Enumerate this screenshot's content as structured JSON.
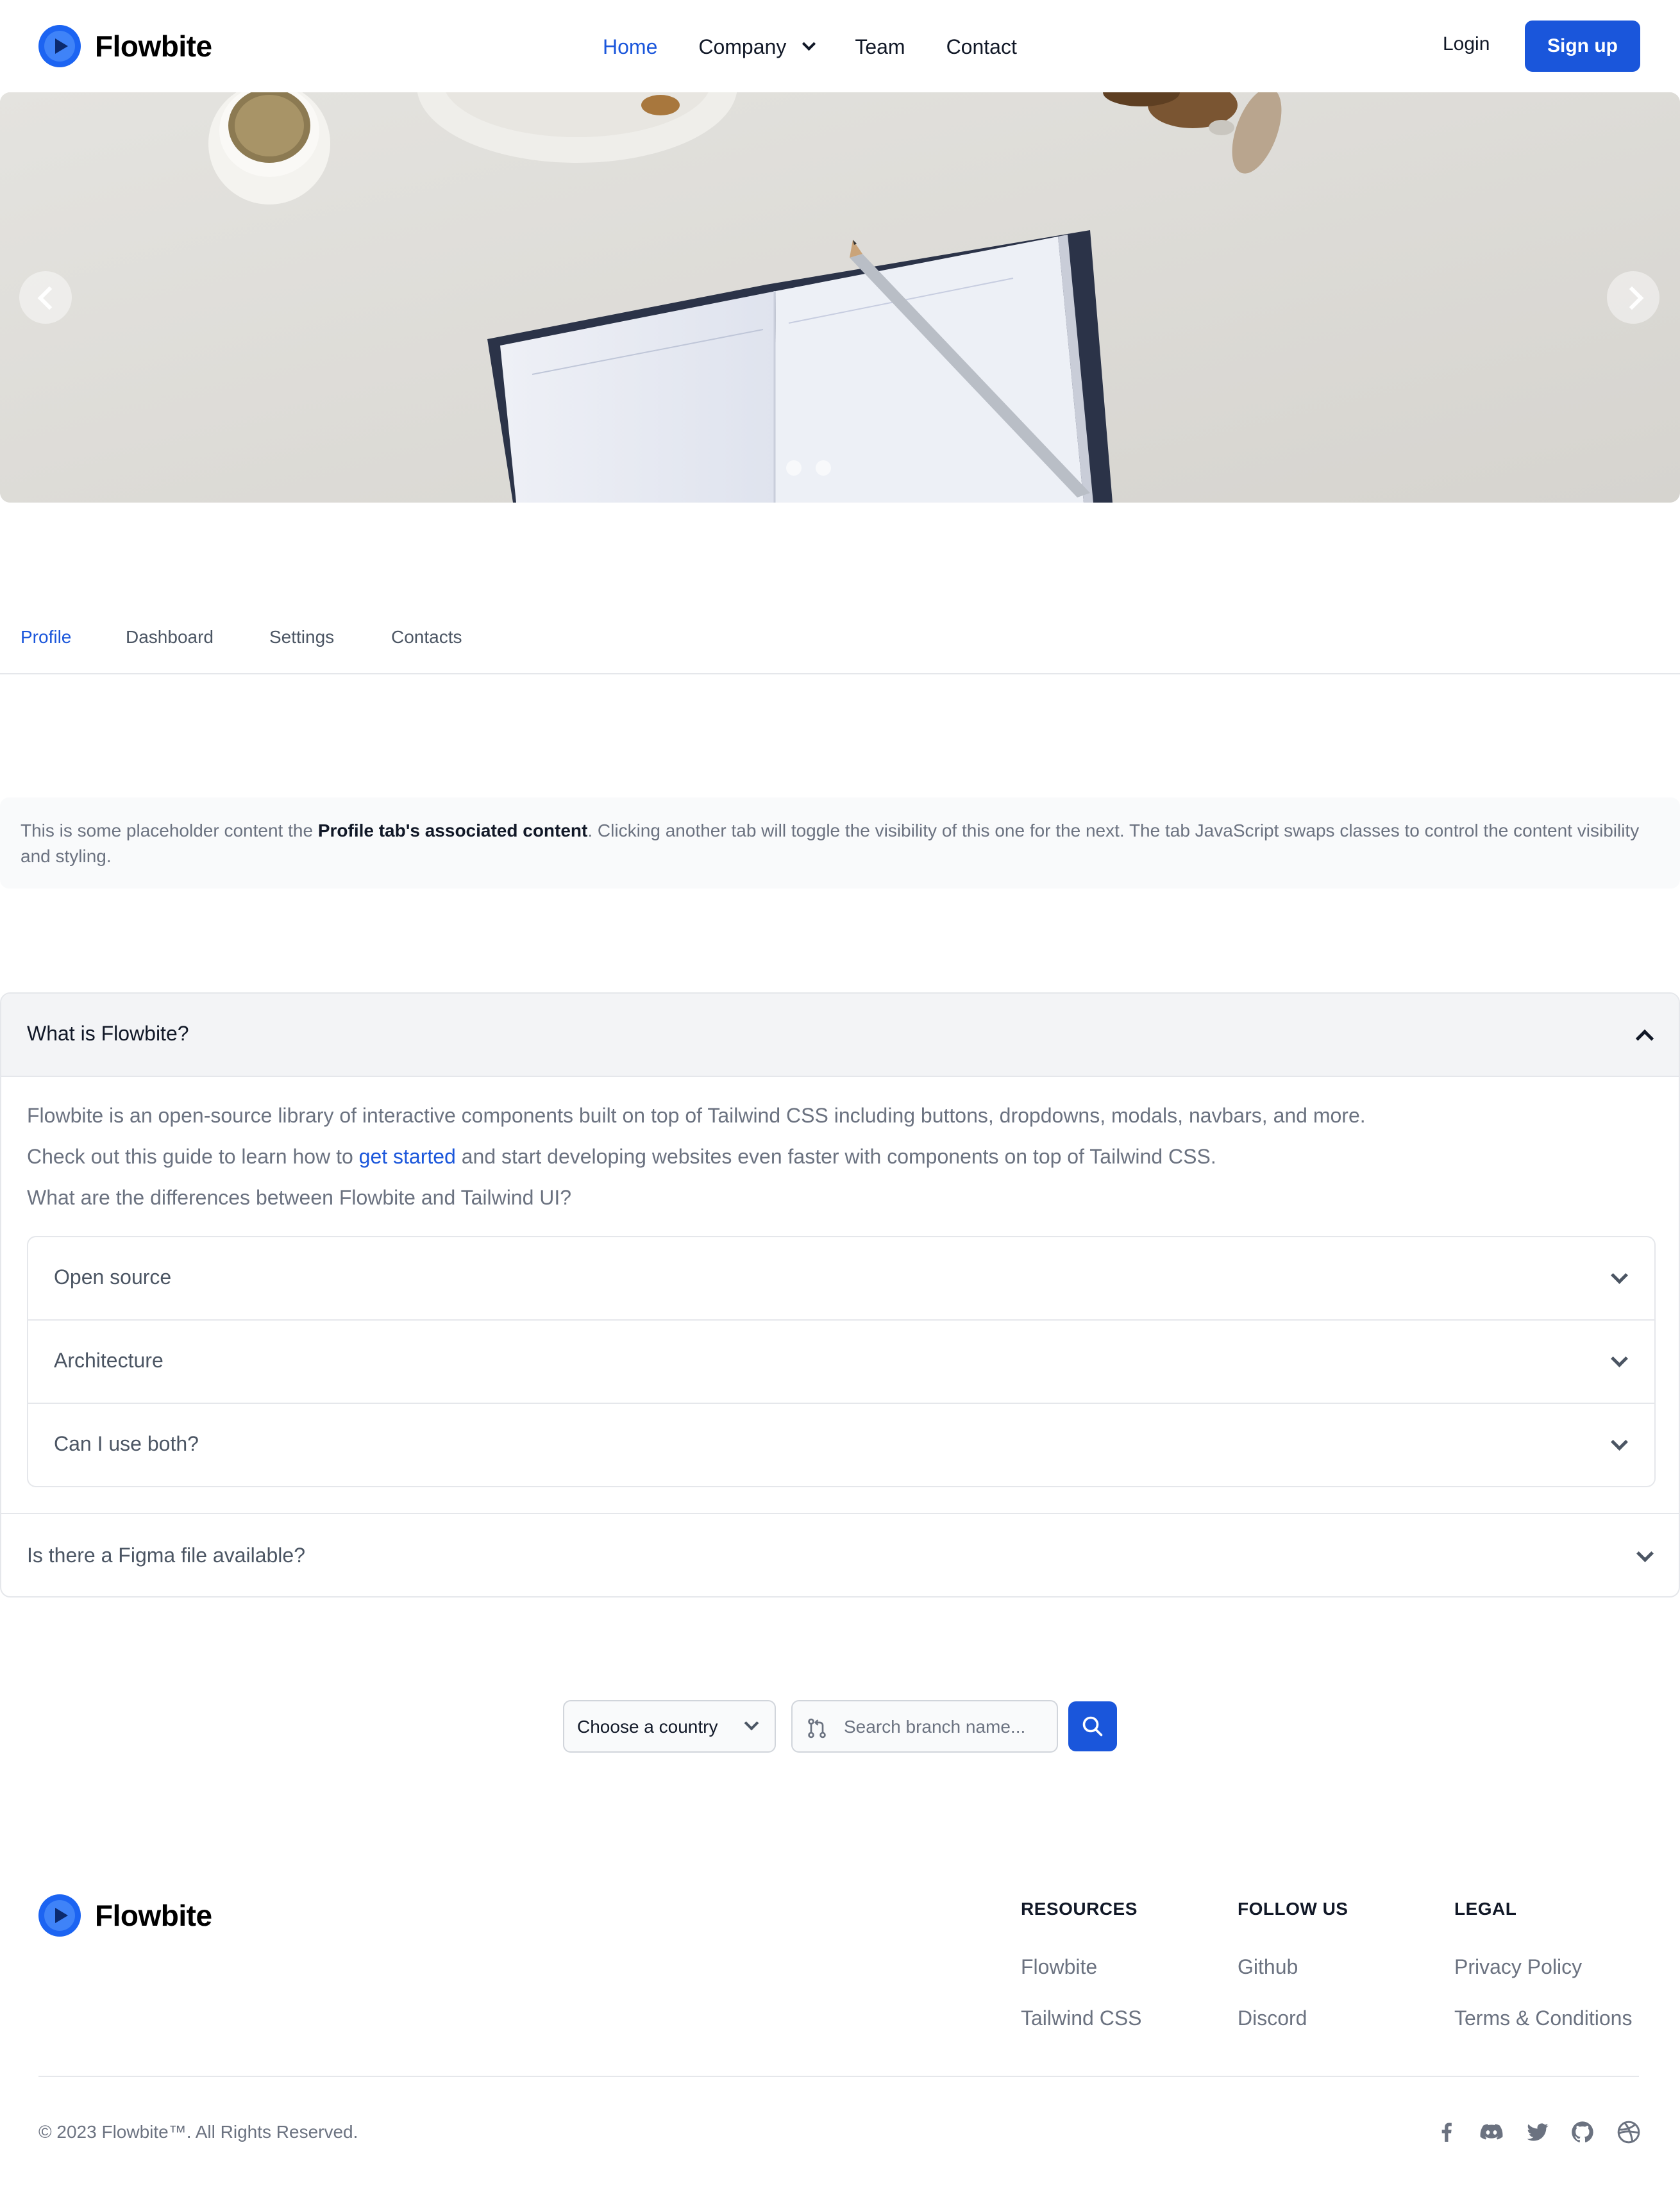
{
  "brand": {
    "name": "Flowbite"
  },
  "nav": {
    "links": [
      {
        "label": "Home"
      },
      {
        "label": "Company"
      },
      {
        "label": "Team"
      },
      {
        "label": "Contact"
      }
    ],
    "login": "Login",
    "signup": "Sign up"
  },
  "tabs": {
    "items": [
      {
        "label": "Profile"
      },
      {
        "label": "Dashboard"
      },
      {
        "label": "Settings"
      },
      {
        "label": "Contacts"
      }
    ],
    "active": "Profile",
    "panel": {
      "before": "This is some placeholder content the ",
      "strong": "Profile tab's associated content",
      "after": ". Clicking another tab will toggle the visibility of this one for the next. The tab JavaScript swaps classes to control the content visibility and styling."
    }
  },
  "accordion": {
    "open_title": "What is Flowbite?",
    "body1": "Flowbite is an open-source library of interactive components built on top of Tailwind CSS including buttons, dropdowns, modals, navbars, and more.",
    "body2_before": "Check out this guide to learn how to ",
    "body2_link": "get started",
    "body2_after": " and start developing websites even faster with components on top of Tailwind CSS.",
    "body3": "What are the differences between Flowbite and Tailwind UI?",
    "nested": [
      {
        "label": "Open source"
      },
      {
        "label": "Architecture"
      },
      {
        "label": "Can I use both?"
      }
    ],
    "last_title": "Is there a Figma file available?"
  },
  "search": {
    "country_label": "Choose a country",
    "branch_placeholder": "Search branch name..."
  },
  "footer": {
    "columns": [
      {
        "title": "RESOURCES",
        "links": [
          "Flowbite",
          "Tailwind CSS"
        ]
      },
      {
        "title": "FOLLOW US",
        "links": [
          "Github",
          "Discord"
        ]
      },
      {
        "title": "LEGAL",
        "links": [
          "Privacy Policy",
          "Terms & Conditions"
        ]
      }
    ],
    "copyright": "© 2023 Flowbite™. All Rights Reserved.",
    "social_icons": [
      "facebook-icon",
      "discord-icon",
      "twitter-icon",
      "github-icon",
      "dribbble-icon"
    ]
  },
  "colors": {
    "primary": "#1a56db",
    "text": "#111827",
    "muted": "#6b7280",
    "border": "#e5e7eb"
  }
}
